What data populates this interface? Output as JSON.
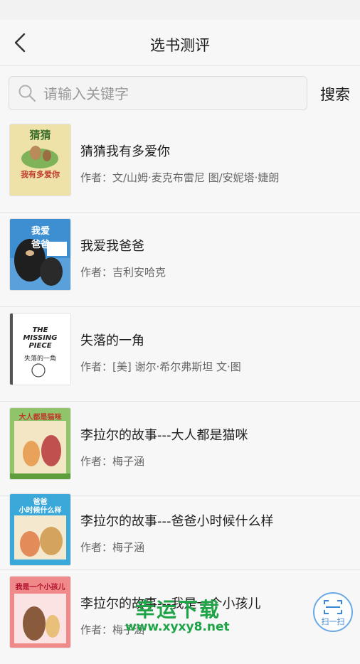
{
  "header": {
    "title": "选书测评"
  },
  "search": {
    "placeholder": "请输入关键字",
    "button_label": "搜索"
  },
  "books": [
    {
      "title": "猜猜我有多爱你",
      "author": "作者：文/山姆·麦克布雷尼 图/安妮塔·婕朗",
      "cover_text": "猜猜\n我有多爱你",
      "cover_color": "#e8d79a"
    },
    {
      "title": "我爱我爸爸",
      "author": "作者：吉利安哈克",
      "cover_text": "我爱\n爸爸",
      "cover_color": "#2e7fc1"
    },
    {
      "title": "失落的一角",
      "author": "作者：[美] 谢尔·希尔弗斯坦 文·图",
      "cover_text": "THE\nMISSING\nPIECE\n失落的一角",
      "cover_color": "#ffffff"
    },
    {
      "title": "李拉尔的故事---大人都是猫咪",
      "author": "作者：梅子涵",
      "cover_text": "大人都是猫咪",
      "cover_color": "#8fc46b"
    },
    {
      "title": "李拉尔的故事---爸爸小时候什么样",
      "author": "作者：梅子涵",
      "cover_text": "爸爸\n小时候什么样",
      "cover_color": "#3aa8d8"
    },
    {
      "title": "李拉尔的故事---我是一个小孩儿",
      "author": "作者：梅子涵",
      "cover_text": "我是一个小孩儿",
      "cover_color": "#f08a8a"
    }
  ],
  "scan": {
    "label": "扫一扫"
  },
  "watermark": {
    "text": "幸运下载",
    "url": "www.xyxy8.net"
  }
}
